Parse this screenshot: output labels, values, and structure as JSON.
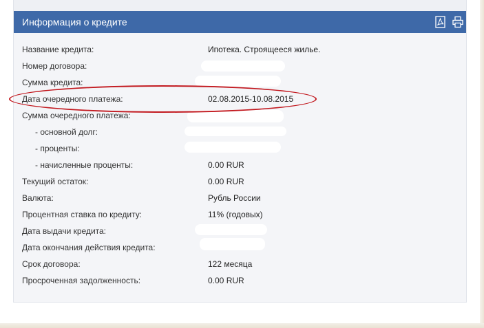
{
  "panel": {
    "title": "Информация о кредите",
    "icons": [
      "pdf-icon",
      "print-icon"
    ]
  },
  "rows": [
    {
      "label": "Название кредита:",
      "value": "Ипотека. Строящееся жилье."
    },
    {
      "label": "Номер договора:",
      "value": ""
    },
    {
      "label": "Сумма кредита:",
      "value": ""
    },
    {
      "label": "Дата очередного платежа:",
      "value": "02.08.2015-10.08.2015"
    },
    {
      "label": "Сумма очередного платежа:",
      "value": ""
    },
    {
      "label": "- основной долг:",
      "value": ""
    },
    {
      "label": "- проценты:",
      "value": ""
    },
    {
      "label": "- начисленные проценты:",
      "value": "0.00 RUR"
    },
    {
      "label": "Текущий остаток:",
      "value": "0.00 RUR"
    },
    {
      "label": "Валюта:",
      "value": "Рубль России"
    },
    {
      "label": "Процентная ставка по кредиту:",
      "value": "11% (годовых)"
    },
    {
      "label": "Дата выдачи кредита:",
      "value": ""
    },
    {
      "label": "Дата окончания действия кредита:",
      "value": ""
    },
    {
      "label": "Срок договора:",
      "value": "122 месяца"
    },
    {
      "label": "Просроченная задолженность:",
      "value": "0.00 RUR"
    }
  ],
  "colors": {
    "header_bg": "#3e69a8",
    "panel_bg": "#f4f5f8",
    "highlight_oval": "#c2191f"
  }
}
